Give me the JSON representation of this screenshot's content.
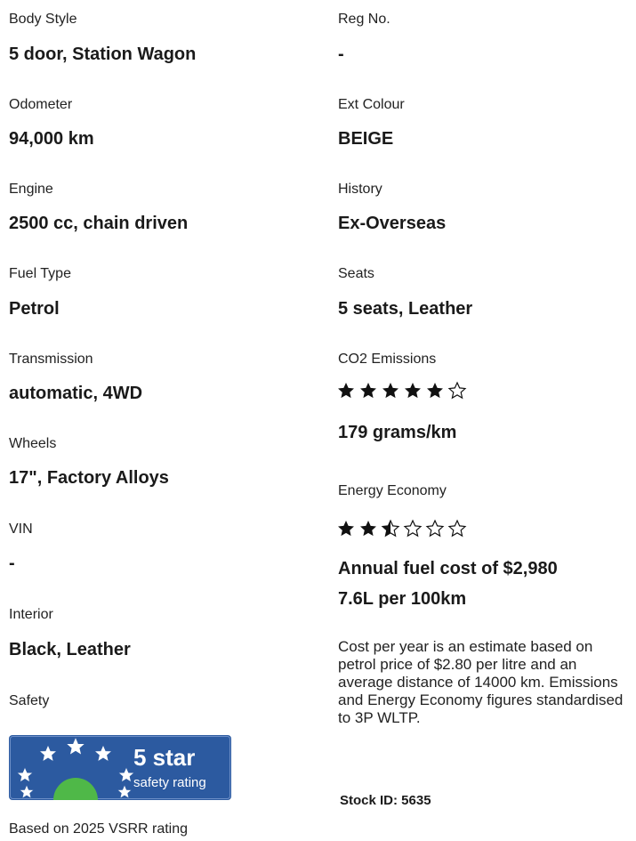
{
  "specs_left": [
    {
      "label": "Body Style",
      "value": "5 door, Station Wagon"
    },
    {
      "label": "Odometer",
      "value": "94,000 km"
    },
    {
      "label": "Engine",
      "value": "2500 cc, chain driven"
    },
    {
      "label": "Fuel Type",
      "value": "Petrol"
    },
    {
      "label": "Transmission",
      "value": "automatic, 4WD"
    },
    {
      "label": "Wheels",
      "value": "17\", Factory Alloys"
    },
    {
      "label": "VIN",
      "value": "-"
    },
    {
      "label": "Interior",
      "value": "Black, Leather"
    }
  ],
  "safety": {
    "label": "Safety",
    "badge_big": "5 star",
    "badge_small": "safety rating",
    "stars": 5,
    "note": "Based on 2025 VSRR rating",
    "badge_color": "#2c5aa0"
  },
  "specs_right": [
    {
      "label": "Reg No.",
      "value": "-"
    },
    {
      "label": "Ext Colour",
      "value": "BEIGE"
    },
    {
      "label": "History",
      "value": "Ex-Overseas"
    },
    {
      "label": "Seats",
      "value": "5 seats, Leather"
    }
  ],
  "co2": {
    "label": "CO2 Emissions",
    "rating": 5,
    "out_of": 6,
    "value": "179 grams/km"
  },
  "energy": {
    "label": "Energy Economy",
    "rating": 2.5,
    "out_of": 6,
    "annual_cost": "Annual fuel cost of $2,980",
    "consumption": "7.6L per 100km"
  },
  "disclaimer": "Cost per year is an estimate based on petrol price of  $2.80 per litre and an average distance of 14000 km. Emissions and Energy Economy figures standardised to 3P WLTP.",
  "stock_id": "Stock ID: 5635",
  "colors": {
    "star": "#111111",
    "badge": "#2c5aa0",
    "badge_green": "#4fb848"
  }
}
